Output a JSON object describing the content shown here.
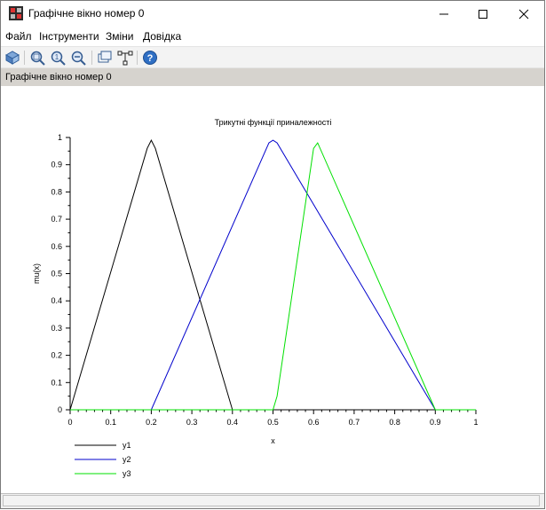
{
  "window": {
    "title": "Графічне вікно номер 0"
  },
  "menu": {
    "items": [
      "Файл",
      "Інструменти",
      "Зміни",
      "Довідка"
    ]
  },
  "toolbar": {
    "icons": [
      "rotate-icon",
      "zoom-in-icon",
      "zoom-reset-icon",
      "zoom-out-icon",
      "datatip-icon",
      "edit-axes-icon",
      "help-icon"
    ]
  },
  "infobar": {
    "text": "Графічне вікно номер 0"
  },
  "colors": {
    "y1": "#000000",
    "y2": "#0000cc",
    "y3": "#00e000"
  },
  "chart_data": {
    "type": "line",
    "title": "Трикутні функції приналежності",
    "xlabel": "x",
    "ylabel": "mu(x)",
    "xlim": [
      0,
      1
    ],
    "ylim": [
      0,
      1
    ],
    "xticks": [
      "0",
      "0.1",
      "0.2",
      "0.3",
      "0.4",
      "0.5",
      "0.6",
      "0.7",
      "0.8",
      "0.9",
      "1"
    ],
    "yticks": [
      "0",
      "0.1",
      "0.2",
      "0.3",
      "0.4",
      "0.5",
      "0.6",
      "0.7",
      "0.8",
      "0.9",
      "1"
    ],
    "legend_position": "bottom-left",
    "series": [
      {
        "name": "y1",
        "color": "#000000",
        "points": [
          [
            0,
            0
          ],
          [
            0.19,
            0.96
          ],
          [
            0.2,
            0.99
          ],
          [
            0.21,
            0.96
          ],
          [
            0.4,
            0
          ],
          [
            0.41,
            0
          ]
        ]
      },
      {
        "name": "y2",
        "color": "#0000cc",
        "points": [
          [
            0,
            0
          ],
          [
            0.2,
            0
          ],
          [
            0.49,
            0.98
          ],
          [
            0.5,
            0.99
          ],
          [
            0.51,
            0.98
          ],
          [
            0.9,
            0
          ],
          [
            1,
            0
          ]
        ]
      },
      {
        "name": "y3",
        "color": "#00e000",
        "points": [
          [
            0,
            0
          ],
          [
            0.5,
            0
          ],
          [
            0.51,
            0.05
          ],
          [
            0.6,
            0.96
          ],
          [
            0.61,
            0.98
          ],
          [
            0.9,
            0
          ],
          [
            1,
            0
          ]
        ]
      }
    ]
  }
}
